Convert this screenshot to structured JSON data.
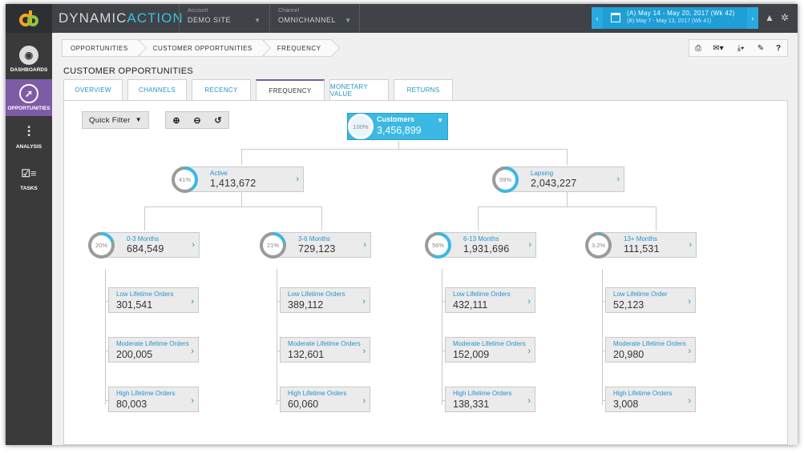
{
  "brand": {
    "part1": "DYNAMIC",
    "part2": "ACTION",
    "logo_icon": "dynamic-action-logo-icon"
  },
  "topbar": {
    "account": {
      "label": "Account",
      "value": "DEMO SITE"
    },
    "channel": {
      "label": "Channel",
      "value": "OMNICHANNEL"
    },
    "date_a": "(A) May 14 - May 20, 2017 (Wk 42)",
    "date_b": "(B) May 7 - May 13, 2017 (Wk 41)"
  },
  "sidebar": [
    {
      "label": "DASHBOARDS",
      "icon": "aperture-icon"
    },
    {
      "label": "OPPORTUNITIES",
      "icon": "compass-icon",
      "active": true
    },
    {
      "label": "ANALYSIS",
      "icon": "sliders-icon"
    },
    {
      "label": "TASKS",
      "icon": "checklist-icon"
    }
  ],
  "breadcrumbs": [
    "OPPORTUNITIES",
    "CUSTOMER OPPORTUNITIES",
    "FREQUENCY"
  ],
  "page_title": "CUSTOMER OPPORTUNITIES",
  "tabs": [
    "OVERVIEW",
    "CHANNELS",
    "RECENCY",
    "FREQUENCY",
    "MONETARY VALUE",
    "RETURNS"
  ],
  "active_tab": "FREQUENCY",
  "quick_filter": "Quick Filter",
  "colors": {
    "accent": "#3bb8e3",
    "purple": "#7e5ba6",
    "link": "#2593c9",
    "ring_track": "#9a9a9a"
  },
  "tree": {
    "root": {
      "label": "Customers",
      "value": "3,456,899",
      "pct": "100%"
    },
    "level1": [
      {
        "label": "Active",
        "value": "1,413,672",
        "pct": "41%",
        "fill": 0.41
      },
      {
        "label": "Lapsing",
        "value": "2,043,227",
        "pct": "59%",
        "fill": 0.59
      }
    ],
    "level2": [
      {
        "label": "0-3 Months",
        "value": "684,549",
        "pct": "20%",
        "fill": 0.2,
        "leaves": [
          {
            "label": "Low Lifetime Orders",
            "value": "301,541"
          },
          {
            "label": "Moderate Lifetime Orders",
            "value": "200,005"
          },
          {
            "label": "High Lifetime Orders",
            "value": "80,003"
          }
        ]
      },
      {
        "label": "3-6 Months",
        "value": "729,123",
        "pct": "21%",
        "fill": 0.21,
        "leaves": [
          {
            "label": "Low Lifetime Orders",
            "value": "389,112"
          },
          {
            "label": "Moderate Lifetime Orders",
            "value": "132,601"
          },
          {
            "label": "High Lifetime Orders",
            "value": "60,060"
          }
        ]
      },
      {
        "label": "6-13 Months",
        "value": "1,931,696",
        "pct": "56%",
        "fill": 0.56,
        "leaves": [
          {
            "label": "Low Lifetime Orders",
            "value": "432,111"
          },
          {
            "label": "Moderate Lifetime Orders",
            "value": "152,009"
          },
          {
            "label": "High Lifetime Orders",
            "value": "138,331"
          }
        ]
      },
      {
        "label": "13+ Months",
        "value": "111,531",
        "pct": "3.2%",
        "fill": 0.032,
        "leaves": [
          {
            "label": "Low Lifetime Order",
            "value": "52,123"
          },
          {
            "label": "Moderate Lifetime Orders",
            "value": "20,980"
          },
          {
            "label": "High Lifetime Orders",
            "value": "3,008"
          }
        ]
      }
    ]
  }
}
